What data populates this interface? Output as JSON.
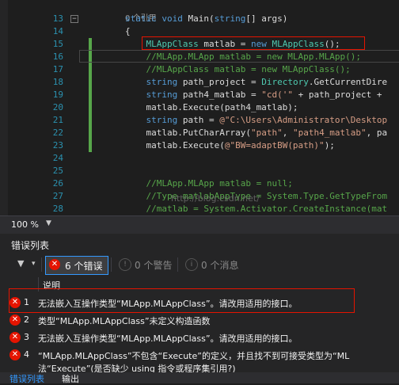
{
  "editor": {
    "ref_count": "0 个引用",
    "lines": [
      {
        "no": "13",
        "tokens": [
          [
            "kw",
            "static "
          ],
          [
            "kw",
            "void "
          ],
          [
            "tx",
            "Main("
          ],
          [
            "kw",
            "string"
          ],
          [
            "tx",
            "[] args)"
          ]
        ]
      },
      {
        "no": "14",
        "tokens": [
          [
            "tx",
            "{"
          ]
        ]
      },
      {
        "no": "15",
        "tokens": [
          [
            "tx",
            "    "
          ],
          [
            "ty",
            "MLAppClass"
          ],
          [
            "tx",
            " matlab = "
          ],
          [
            "kw",
            "new "
          ],
          [
            "ty",
            "MLAppClass"
          ],
          [
            "tx",
            "();"
          ]
        ]
      },
      {
        "no": "16",
        "tokens": [
          [
            "tx",
            "    "
          ],
          [
            "cm",
            "//MLApp.MLApp matlab = new MLApp.MLApp();"
          ]
        ]
      },
      {
        "no": "17",
        "tokens": [
          [
            "tx",
            "    "
          ],
          [
            "cm",
            "//MLAppClass matlab = new MLAppClass();"
          ]
        ]
      },
      {
        "no": "18",
        "tokens": [
          [
            "tx",
            "    "
          ],
          [
            "kw",
            "string"
          ],
          [
            "tx",
            " path_project = "
          ],
          [
            "ty",
            "Directory"
          ],
          [
            "tx",
            ".GetCurrentDire"
          ]
        ]
      },
      {
        "no": "19",
        "tokens": [
          [
            "tx",
            "    "
          ],
          [
            "kw",
            "string"
          ],
          [
            "tx",
            " path4_matlab = "
          ],
          [
            "st",
            "\"cd('\""
          ],
          [
            "tx",
            " + path_project + "
          ]
        ]
      },
      {
        "no": "20",
        "tokens": [
          [
            "tx",
            "    matlab.Execute(path4_matlab);"
          ]
        ]
      },
      {
        "no": "21",
        "tokens": [
          [
            "tx",
            "    "
          ],
          [
            "kw",
            "string"
          ],
          [
            "tx",
            " path = "
          ],
          [
            "st",
            "@\"C:\\Users\\Administrator\\Desktop"
          ]
        ]
      },
      {
        "no": "22",
        "tokens": [
          [
            "tx",
            "    matlab.PutCharArray("
          ],
          [
            "st",
            "\"path\""
          ],
          [
            "tx",
            ", "
          ],
          [
            "st",
            "\"path4_matlab\""
          ],
          [
            "tx",
            ", pa"
          ]
        ]
      },
      {
        "no": "23",
        "tokens": [
          [
            "tx",
            "    matlab.Execute("
          ],
          [
            "st",
            "@\"BW=adaptBW(path)\""
          ],
          [
            "tx",
            ");"
          ]
        ]
      },
      {
        "no": "24",
        "tokens": []
      },
      {
        "no": "25",
        "tokens": []
      },
      {
        "no": "26",
        "tokens": [
          [
            "tx",
            "    "
          ],
          [
            "cm",
            "//MLApp.MLApp matlab = null;"
          ]
        ]
      },
      {
        "no": "27",
        "tokens": [
          [
            "tx",
            "    "
          ],
          [
            "cm",
            "//Type matlabAppType = System.Type.GetTypeFrom"
          ]
        ]
      },
      {
        "no": "28",
        "tokens": [
          [
            "tx",
            "    "
          ],
          [
            "cm",
            "//matlab = System.Activator.CreateInstance(mat"
          ]
        ]
      }
    ],
    "watermark": "http://blog.csdn.net/"
  },
  "zoom": "100 %",
  "error_list": {
    "title": "错误列表",
    "errors_btn": "6 个错误",
    "warnings_btn": "0 个警告",
    "messages_btn": "0 个消息",
    "column_header": "说明",
    "rows": [
      {
        "num": "1",
        "text": "无法嵌入互操作类型“MLApp.MLAppClass”。请改用适用的接口。"
      },
      {
        "num": "2",
        "text": "类型“MLApp.MLAppClass”未定义构造函数"
      },
      {
        "num": "3",
        "text": "无法嵌入互操作类型“MLApp.MLAppClass”。请改用适用的接口。"
      },
      {
        "num": "4",
        "text": "“MLApp.MLAppClass”不包含“Execute”的定义，并且找不到可接受类型为“ML"
      },
      {
        "num": "",
        "text": "法“Execute”(是否缺少 using 指令或程序集引用?)"
      }
    ]
  },
  "bottom_tabs": [
    "错误列表",
    "输出"
  ],
  "colors": {
    "accent": "#3399ff",
    "error": "#e51400",
    "comment": "#57a64a"
  }
}
